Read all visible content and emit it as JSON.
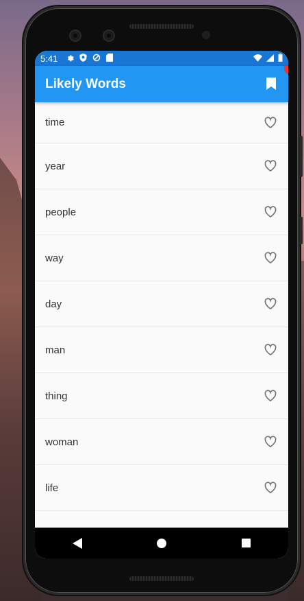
{
  "status_bar": {
    "time": "5:41",
    "icons": [
      "settings-icon",
      "shield-icon",
      "data-saver-icon",
      "sd-card-icon"
    ],
    "right_icons": [
      "wifi-icon",
      "signal-icon",
      "battery-icon"
    ]
  },
  "app_bar": {
    "title": "Likely Words",
    "action_icon": "bookmark-icon"
  },
  "words": [
    {
      "label": "time"
    },
    {
      "label": "year"
    },
    {
      "label": "people"
    },
    {
      "label": "way"
    },
    {
      "label": "day"
    },
    {
      "label": "man"
    },
    {
      "label": "thing"
    },
    {
      "label": "woman"
    },
    {
      "label": "life"
    }
  ],
  "nav_bar": {
    "back": "back-icon",
    "home": "home-icon",
    "recents": "recents-icon"
  },
  "colors": {
    "status_bar": "#1976d2",
    "app_bar": "#2196f3",
    "list_background": "#fafafa"
  }
}
